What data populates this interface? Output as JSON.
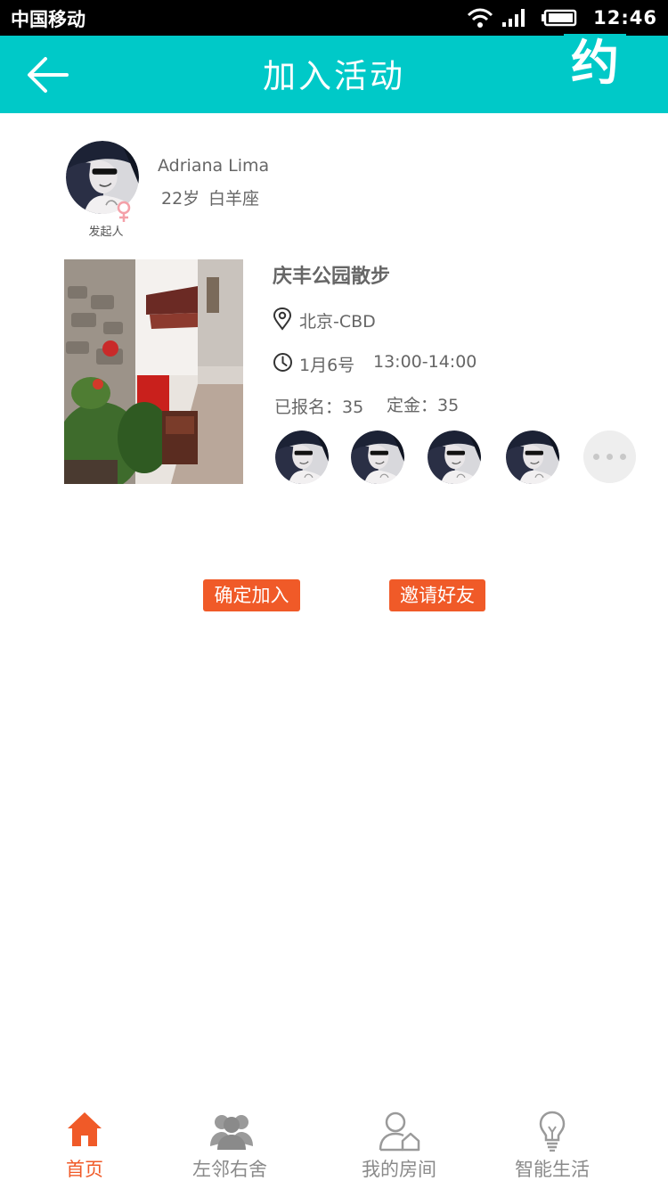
{
  "status_bar": {
    "carrier": "中国移动",
    "time": "12:46"
  },
  "header": {
    "title": "加入活动",
    "badge": "约"
  },
  "initiator": {
    "name": "Adriana Lima",
    "age": "22岁",
    "sign": "白羊座",
    "role": "发起人"
  },
  "activity": {
    "title": "庆丰公园散步",
    "location": "北京-CBD",
    "date": "1月6号",
    "time": "13:00-14:00",
    "signed_up": "已报名：35",
    "deposit": "定金：35"
  },
  "actions": {
    "confirm": "确定加入",
    "invite": "邀请好友"
  },
  "tabs": [
    {
      "label": "首页",
      "icon": "home-icon",
      "active": true
    },
    {
      "label": "左邻右舍",
      "icon": "neighbors-icon",
      "active": false
    },
    {
      "label": "我的房间",
      "icon": "my-room-icon",
      "active": false
    },
    {
      "label": "智能生活",
      "icon": "smart-life-icon",
      "active": false
    }
  ],
  "colors": {
    "header": "#00c9c8",
    "accent": "#f05a28",
    "text": "#666666"
  }
}
